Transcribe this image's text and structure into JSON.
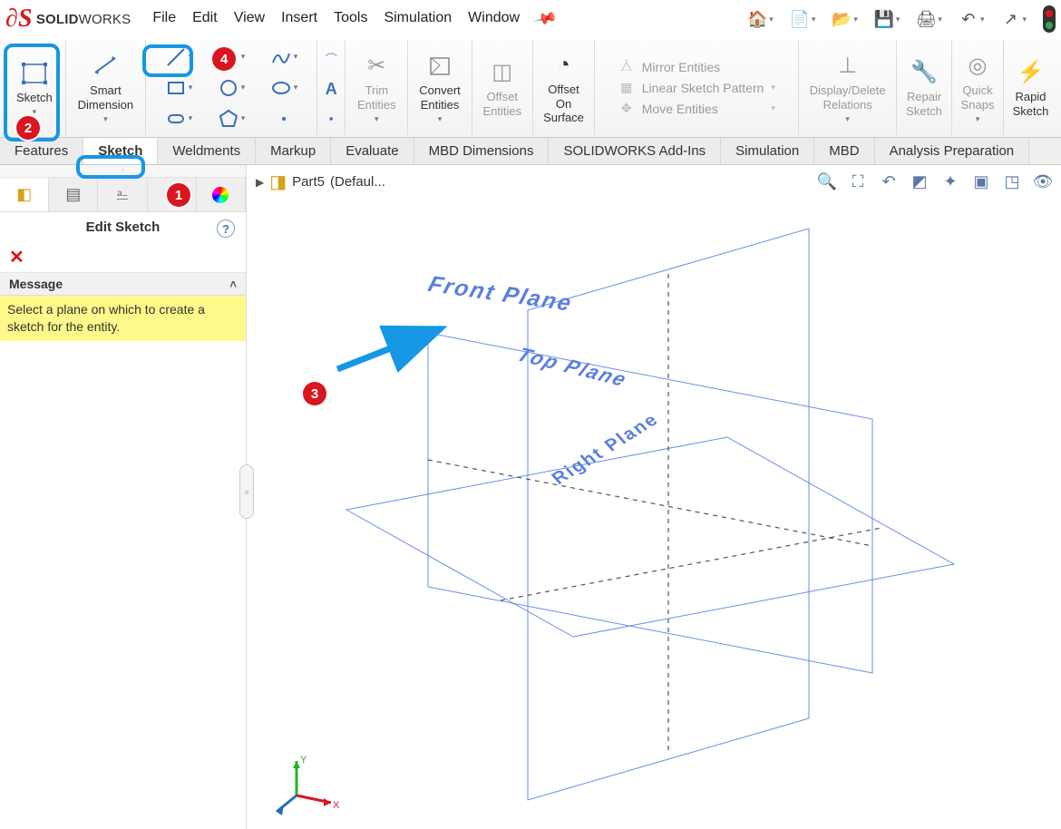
{
  "app": {
    "logo_bold": "SOLID",
    "logo_light": "WORKS"
  },
  "menu": {
    "items": [
      "File",
      "Edit",
      "View",
      "Insert",
      "Tools",
      "Simulation",
      "Window"
    ]
  },
  "ribbon": {
    "sketch": "Sketch",
    "smart_dimension": "Smart\nDimension",
    "trim": "Trim\nEntities",
    "convert": "Convert\nEntities",
    "offset_entities": "Offset\nEntities",
    "offset_surface": "Offset\nOn\nSurface",
    "mirror": "Mirror Entities",
    "pattern": "Linear Sketch Pattern",
    "move": "Move Entities",
    "display_delete": "Display/Delete\nRelations",
    "repair": "Repair\nSketch",
    "quick_snaps": "Quick\nSnaps",
    "rapid_sketch": "Rapid\nSketch"
  },
  "tabs": [
    "Features",
    "Sketch",
    "Weldments",
    "Markup",
    "Evaluate",
    "MBD Dimensions",
    "SOLIDWORKS Add-Ins",
    "Simulation",
    "MBD",
    "Analysis Preparation"
  ],
  "panel": {
    "title": "Edit Sketch",
    "section": "Message",
    "message": "Select a plane on which to create a sketch for the entity."
  },
  "breadcrumb": {
    "part": "Part5",
    "extra": "(Defaul..."
  },
  "planes": {
    "front": "Front Plane",
    "top": "Top Plane",
    "right": "Right Plane"
  },
  "callouts": {
    "c1": "1",
    "c2": "2",
    "c3": "3",
    "c4": "4"
  }
}
